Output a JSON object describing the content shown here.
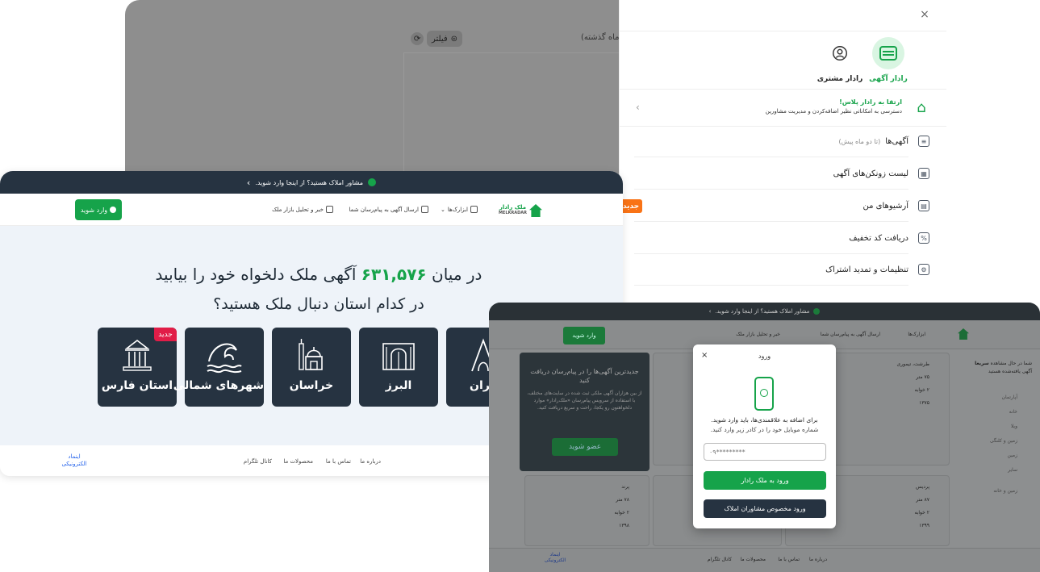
{
  "back": {
    "filter_label": "فیلتر",
    "note": "(ماه گذشته)",
    "close": "×",
    "tabs": [
      {
        "label": "رادار آگهی",
        "active": true
      },
      {
        "label": "رادار مشتری",
        "active": false
      }
    ],
    "upgrade": {
      "title": "ارتقا به رادار پلاس!",
      "desc": "دسترسی به امکاناتی نظیر اضافه‌کردن و مدیریت مشاورین"
    },
    "menu": [
      {
        "label": "آگهی‌ها",
        "sub": "(تا دو ماه پیش)"
      },
      {
        "label": "لیست زونکن‌های آگهی",
        "sub": ""
      },
      {
        "label": "آرشیوهای من",
        "sub": ""
      },
      {
        "label": "دریافت کد تخفیف",
        "sub": ""
      },
      {
        "label": "تنظیمات و تمدید اشتراک",
        "sub": ""
      }
    ],
    "new_badge": "جدید"
  },
  "left": {
    "announcement": "مشاور املاک هستید؟ از اینجا وارد شوید.",
    "logo": {
      "fa": "ملک رادار",
      "en": "MELKRADAR"
    },
    "nav": {
      "tools": "ابزارک‌ها",
      "send_ads": "ارسال آگهی به پیام‌رسان شما",
      "news": "خبر و تحلیل بازار ملک"
    },
    "login": "وارد شوید",
    "hero": {
      "title_pre": "در میان",
      "count": "۶۳۱,۵۷۶",
      "title_post": "آگهی ملک دلخواه خود را بیابید",
      "subtitle": "در کدام استان دنبال ملک هستید؟"
    },
    "provinces": [
      {
        "name": "استان فارس",
        "icon": "tomb-icon"
      },
      {
        "name": "شهرهای شمالی",
        "icon": "wave-icon"
      },
      {
        "name": "خراسان",
        "icon": "shrine-icon"
      },
      {
        "name": "البرز",
        "icon": "gate-icon"
      },
      {
        "name": "تهران",
        "icon": "tower-icon"
      }
    ],
    "new_badge": "جدید",
    "footer": {
      "about": "درباره ما",
      "contact": "تماس با ما",
      "products": "محصولات ما",
      "telegram": "کانال تلگرام",
      "enamad": "اینماد الکترونیکی"
    }
  },
  "right": {
    "announcement": "مشاور املاک هستید؟ از اینجا وارد شوید.",
    "login": "وارد شوید",
    "nav": {
      "tools": "ابزارک‌ها",
      "send_ads": "ارسال آگهی به پیام‌رسان شما",
      "news": "خبر و تحلیل بازار ملک"
    },
    "promo": {
      "title": "جدیدترین آگهی‌ها را در پیام‌رسان دریافت کنید",
      "desc": "از بین هزاران آگهی ملکی ثبت شده در سایت‌های مختلف، با استفاده از سرویس پیام‌رسان «ملک‌رادار» موارد دلخواهتون رو یکجا، راحت و سریع دریافت کنید.",
      "join": "عضو شوید"
    },
    "cards": [
      {
        "area": "طرشت، تیموری",
        "size": "۷۵ متر",
        "rooms": "۲ خوابه",
        "year": "۱۳۷۵"
      },
      {
        "area": "پرند",
        "size": "۷۸ متر",
        "rooms": "۲ خوابه",
        "year": "۱۳۹۸"
      },
      {
        "area": "پردیس",
        "size": "۸۷ متر",
        "rooms": "۲ خوابه",
        "year": "۱۳۹۹"
      }
    ],
    "side": {
      "viewing": "شما در حال مشاهده",
      "viewing_hl": "سریعا",
      "viewing_tail": "آگهی یافته‌شده هستید",
      "filters": [
        "آپارتمان",
        "خانه",
        "ویلا",
        "زمین و کلنگی",
        "زمین",
        "سایر",
        "زمین و خانه"
      ]
    },
    "footer": {
      "about": "درباره ما",
      "contact": "تماس با ما",
      "products": "محصولات ما",
      "telegram": "کانال تلگرام",
      "enamad": "اینماد الکترونیکی"
    },
    "modal": {
      "title": "ورود",
      "text1": "برای اضافه به علاقمندی‌ها، باید وارد شوید.",
      "text2": "شماره موبایل خود را در کادر زیر وارد کنید.",
      "placeholder": "۰۹*********",
      "btn_login": "ورود به ملک رادار",
      "btn_agents": "ورود مخصوص مشاوران املاک"
    }
  }
}
